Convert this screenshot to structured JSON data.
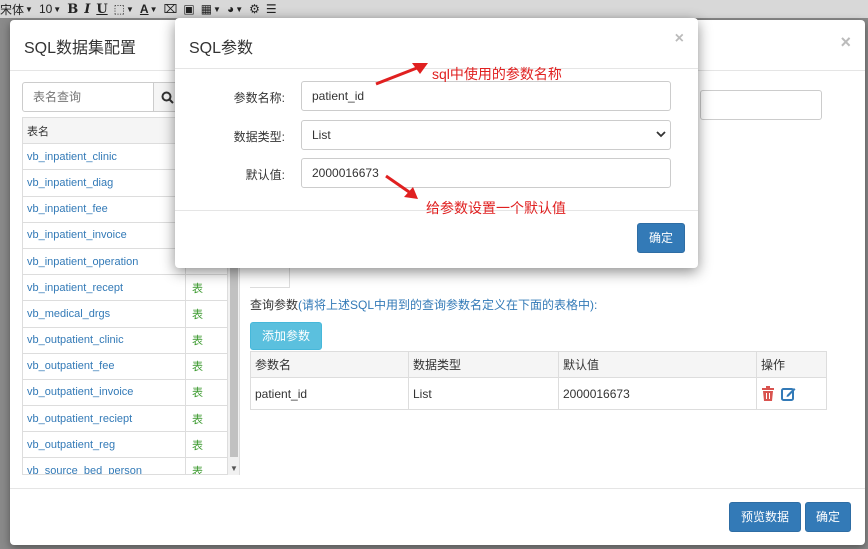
{
  "toolbar": {
    "font_name": "宋体",
    "font_size": "10",
    "bold": "B",
    "italic": "I",
    "underline": "U",
    "font_color": "A"
  },
  "main_dialog": {
    "title": "SQL数据集配置",
    "close": "×",
    "search": {
      "placeholder": "表名查询"
    },
    "table_list": {
      "header": {
        "name": "表名",
        "type": ""
      },
      "rows": [
        {
          "name": "vb_inpatient_clinic",
          "type": ""
        },
        {
          "name": "vb_inpatient_diag",
          "type": ""
        },
        {
          "name": "vb_inpatient_fee",
          "type": ""
        },
        {
          "name": "vb_inpatient_invoice",
          "type": ""
        },
        {
          "name": "vb_inpatient_operation",
          "type": ""
        },
        {
          "name": "vb_inpatient_recept",
          "type": "表"
        },
        {
          "name": "vb_medical_drgs",
          "type": "表"
        },
        {
          "name": "vb_outpatient_clinic",
          "type": "表"
        },
        {
          "name": "vb_outpatient_fee",
          "type": "表"
        },
        {
          "name": "vb_outpatient_invoice",
          "type": "表"
        },
        {
          "name": "vb_outpatient_reciept",
          "type": "表"
        },
        {
          "name": "vb_outpatient_reg",
          "type": "表"
        },
        {
          "name": "vb_source_bed_person",
          "type": "表"
        }
      ]
    },
    "params_label_prefix": "查询参数",
    "params_label_hint": "(请将上述SQL中用到的查询参数名定义在下面的表格中):",
    "add_param_button": "添加参数",
    "params_table": {
      "headers": [
        "参数名",
        "数据类型",
        "默认值",
        "操作"
      ],
      "rows": [
        {
          "name": "patient_id",
          "type": "List",
          "default": "2000016673"
        }
      ]
    },
    "preview_button": "预览数据",
    "confirm_button": "确定"
  },
  "sql_param_dialog": {
    "title": "SQL参数",
    "close": "×",
    "name_label": "参数名称:",
    "name_value": "patient_id",
    "type_label": "数据类型:",
    "type_value": "List",
    "default_label": "默认值:",
    "default_value": "2000016673",
    "confirm_button": "确定"
  },
  "annotations": {
    "name_note": "sql中使用的参数名称",
    "default_note": "给参数设置一个默认值",
    "color": "#e02020"
  },
  "colors": {
    "primary": "#337ab7",
    "info": "#5bc0de",
    "table_type": "#3c9a2f",
    "delete": "#d9534f"
  }
}
